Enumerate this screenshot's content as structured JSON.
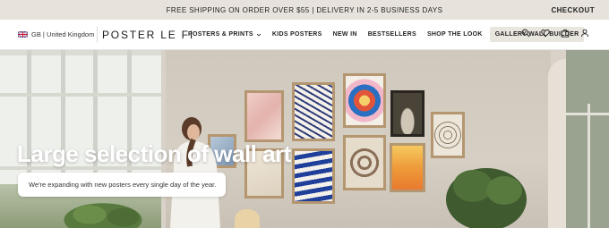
{
  "topbar": {
    "promo": "FREE SHIPPING ON ORDER OVER $55 | DELIVERY IN 2-5 BUSINESS DAYS",
    "checkout": "CHECKOUT"
  },
  "header": {
    "region": "GB | United Kingdom",
    "logo": "POSTER LE FI",
    "menu": [
      {
        "label": "POSTERS & PRINTS"
      },
      {
        "label": "KIDS POSTERS"
      },
      {
        "label": "NEW IN"
      },
      {
        "label": "BESTSELLERS"
      },
      {
        "label": "SHOP THE LOOK"
      },
      {
        "label": "GALLERY WALL BUILDER"
      }
    ],
    "icons": [
      "search-icon",
      "heart-icon",
      "cart-icon",
      "account-icon"
    ]
  },
  "hero": {
    "headline": "Large selection of wall art",
    "subtext": "We're expanding with new posters every single day of the year."
  },
  "colors": {
    "topbar_bg": "#e7e3dc",
    "gallery_button_bg": "#e9e5df",
    "frame": "#b49670"
  }
}
